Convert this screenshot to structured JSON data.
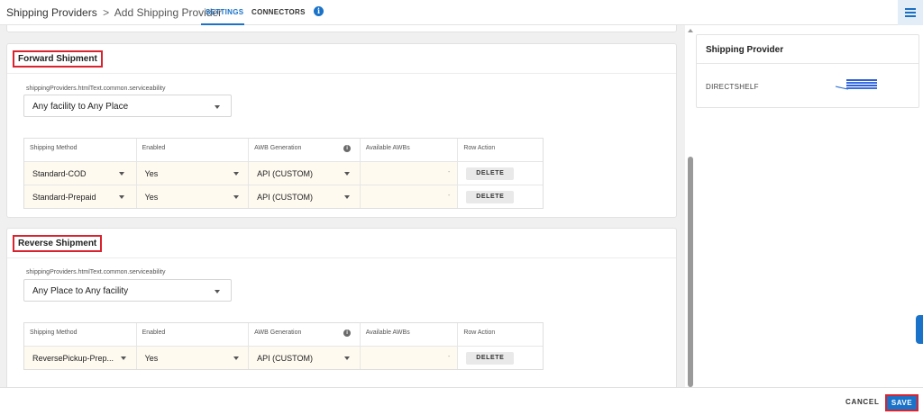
{
  "header": {
    "breadcrumb_root": "Shipping Providers",
    "breadcrumb_sep": ">",
    "breadcrumb_current": "Add Shipping Provider",
    "tabs": [
      {
        "label": "SETTINGS",
        "active": true
      },
      {
        "label": "CONNECTORS",
        "active": false
      }
    ],
    "info_icon": "i",
    "menu_icon": "hamburger-menu-icon",
    "accent_color": "#1a73c9"
  },
  "forward": {
    "title": "Forward Shipment",
    "serviceability_label": "shippingProviders.htmlText.common.serviceability",
    "serviceability_value": "Any facility to Any Place",
    "columns": [
      "Shipping Method",
      "Enabled",
      "AWB Generation",
      "Available AWBs",
      "Row Action"
    ],
    "rows": [
      {
        "method": "Standard-COD",
        "enabled": "Yes",
        "awb": "API (CUSTOM)",
        "available": "-",
        "action": "DELETE"
      },
      {
        "method": "Standard-Prepaid",
        "enabled": "Yes",
        "awb": "API (CUSTOM)",
        "available": "-",
        "action": "DELETE"
      }
    ]
  },
  "reverse": {
    "title": "Reverse Shipment",
    "serviceability_label": "shippingProviders.htmlText.common.serviceability",
    "serviceability_value": "Any Place to Any facility",
    "columns": [
      "Shipping Method",
      "Enabled",
      "AWB Generation",
      "Available AWBs",
      "Row Action"
    ],
    "rows": [
      {
        "method": "ReversePickup-Prep...",
        "enabled": "Yes",
        "awb": "API (CUSTOM)",
        "available": "-",
        "action": "DELETE"
      }
    ]
  },
  "provider_panel": {
    "title": "Shipping Provider",
    "name": "DIRECTSHELF"
  },
  "footer": {
    "cancel_label": "CANCEL",
    "save_label": "SAVE",
    "highlight_color": "#d9232e"
  }
}
